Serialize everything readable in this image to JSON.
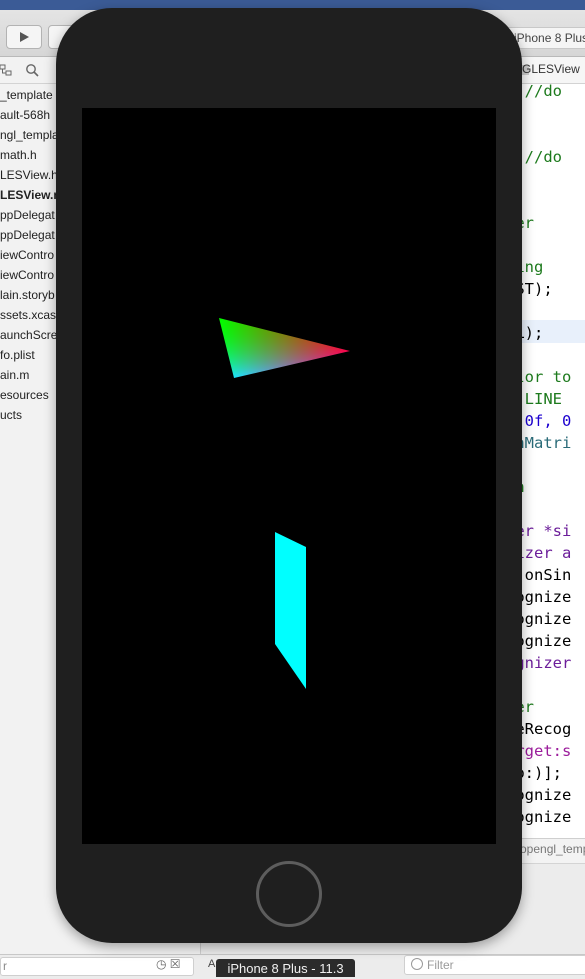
{
  "xcode": {
    "scheme_device": "iPhone 8 Plus",
    "navigator_files": [
      {
        "label": "_template",
        "selected": false
      },
      {
        "label": "ault-568h",
        "selected": false
      },
      {
        "label": "ngl_templa",
        "selected": false
      },
      {
        "label": "math.h",
        "selected": false
      },
      {
        "label": "LESView.h",
        "selected": false
      },
      {
        "label": "LESView.m",
        "selected": true
      },
      {
        "label": "ppDelegat",
        "selected": false
      },
      {
        "label": "ppDelegat",
        "selected": false
      },
      {
        "label": "iewContro",
        "selected": false
      },
      {
        "label": "iewContro",
        "selected": false
      },
      {
        "label": "lain.storyb",
        "selected": false
      },
      {
        "label": "ssets.xcass",
        "selected": false
      },
      {
        "label": "aunchScre",
        "selected": false
      },
      {
        "label": "fo.plist",
        "selected": false
      },
      {
        "label": "ain.m",
        "selected": false
      },
      {
        "label": "esources",
        "selected": false
      },
      {
        "label": "ucts",
        "selected": false
      }
    ],
    "jump_file": "GLESView",
    "debug_file": "opengl_templ",
    "bottom_left_filter": "r",
    "bottom_left_letter": "A",
    "right_filter_placeholder": "Filter",
    "code_lines": [
      {
        "text": "; //do",
        "color": "green"
      },
      {
        "text": "; //do",
        "color": "green"
      },
      {
        "text": ");",
        "color": "black"
      },
      {
        "text": "ger",
        "color": "green"
      },
      {
        "text": "ting",
        "color": "green"
      },
      {
        "text": "EST);",
        "color": "black"
      },
      {
        "text": "AL);",
        "color": "black"
      },
      {
        "text": "olor to",
        "color": "green"
      },
      {
        "text": "S LINE",
        "color": "green"
      },
      {
        "text": "0.0f, 0",
        "color": "blue"
      },
      {
        "text": "onMatri",
        "color": "teal"
      },
      {
        "text": "on",
        "color": "green"
      },
      {
        "text": "zer *si",
        "color": "purple"
      },
      {
        "text": "nizer a",
        "color": "purple"
      },
      {
        "text": "r(onSin",
        "color": "black"
      },
      {
        "text": "cognize",
        "color": "black"
      },
      {
        "text": "cognize",
        "color": "black"
      },
      {
        "text": "cognize",
        "color": "black"
      },
      {
        "text": "ognizer",
        "color": "purple"
      },
      {
        "text": "zer",
        "color": "green"
      },
      {
        "text": "reRecog",
        "color": "black"
      },
      {
        "text": "arget:s",
        "color": "magenta"
      },
      {
        "text": "ap:)];",
        "color": "black"
      },
      {
        "text": "cognize",
        "color": "black"
      },
      {
        "text": "cognize",
        "color": "black"
      }
    ]
  },
  "simulator": {
    "device_label": "iPhone 8 Plus - 11.3",
    "scene": {
      "triangle_colors": [
        "#00ff00",
        "#ff0000",
        "#0000ff"
      ],
      "quad_color": "#00ffff"
    }
  },
  "icons": {
    "run": "play-icon",
    "stop": "stop-icon",
    "hierarchy": "hierarchy-icon",
    "search": "search-icon",
    "filter": "filter-icon",
    "home": "home-button"
  }
}
